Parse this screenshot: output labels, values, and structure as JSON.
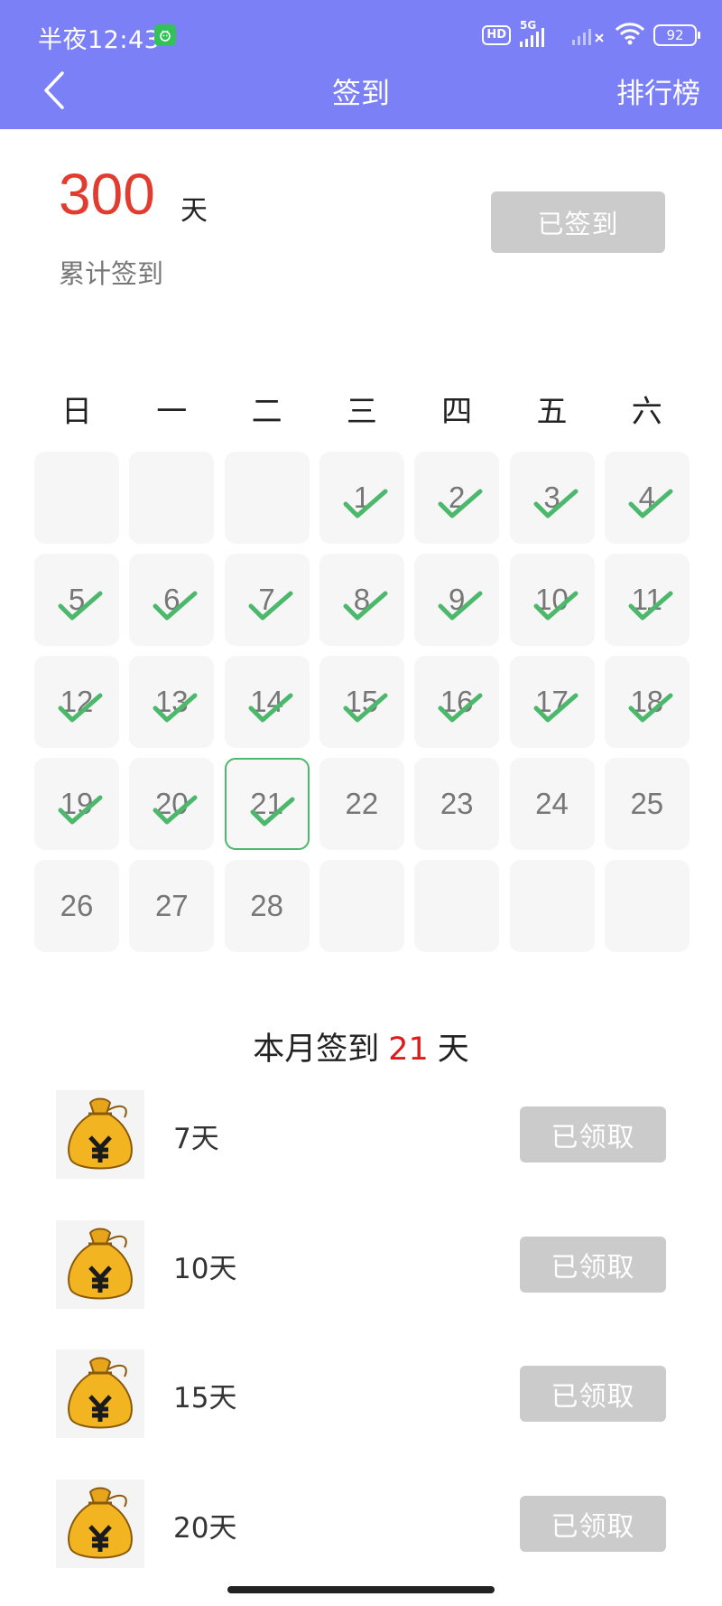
{
  "status": {
    "time": "半夜12:43",
    "hd": "HD",
    "network": "5G",
    "battery": "92"
  },
  "nav": {
    "title": "签到",
    "ranking": "排行榜"
  },
  "summary": {
    "total_days": "300",
    "unit": "天",
    "label": "累计签到",
    "button": "已签到"
  },
  "calendar": {
    "weekdays": [
      "日",
      "一",
      "二",
      "三",
      "四",
      "五",
      "六"
    ],
    "first_weekday_index": 3,
    "days_in_month": 28,
    "today": 21,
    "checked_days": [
      1,
      2,
      3,
      4,
      5,
      6,
      7,
      8,
      9,
      10,
      11,
      12,
      13,
      14,
      15,
      16,
      17,
      18,
      19,
      20,
      21
    ]
  },
  "month_summary": {
    "prefix": "本月签到",
    "count": "21",
    "suffix": "天"
  },
  "rewards": [
    {
      "label": "7天",
      "button": "已领取"
    },
    {
      "label": "10天",
      "button": "已领取"
    },
    {
      "label": "15天",
      "button": "已领取"
    },
    {
      "label": "20天",
      "button": "已领取"
    }
  ],
  "colors": {
    "header": "#7c80f6",
    "accent_red": "#e23b30",
    "check_green": "#4cb86b",
    "disabled_button": "#cbcbcb"
  }
}
